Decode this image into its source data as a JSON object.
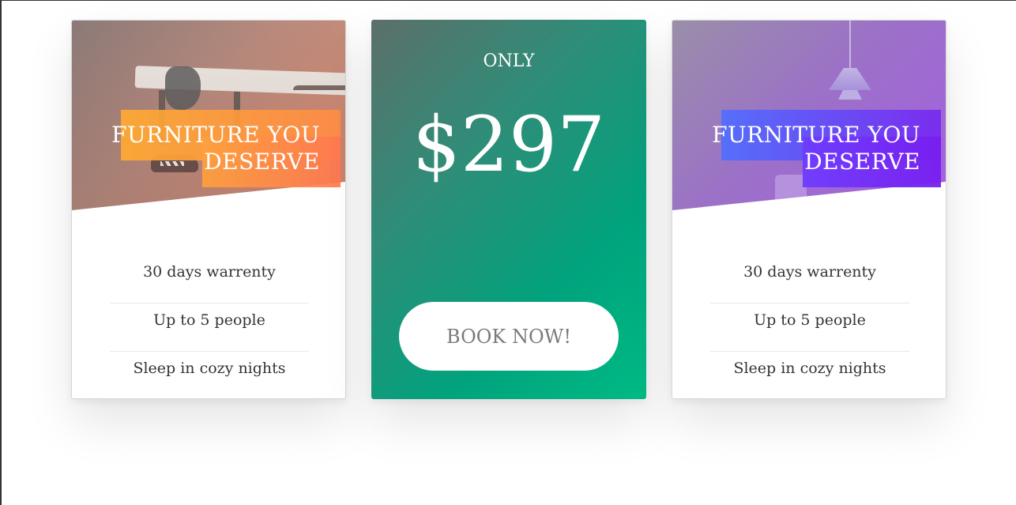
{
  "cards": [
    {
      "headline_line1": "FURNITURE YOU",
      "headline_line2": "DESERVE",
      "theme": "orange",
      "accent_colors": [
        "#ffaa32",
        "#ff7850"
      ],
      "features": [
        "30 days warrenty",
        "Up to 5 people",
        "Sleep in cozy nights"
      ]
    },
    {
      "label": "ONLY",
      "price": "$297",
      "button_label": "BOOK NOW!",
      "accent_colors": [
        "#5c6f6a",
        "#00bb84"
      ]
    },
    {
      "headline_line1": "FURNITURE YOU",
      "headline_line2": "DESERVE",
      "theme": "purple",
      "accent_colors": [
        "#506eff",
        "#7828f0"
      ],
      "features": [
        "30 days warrenty",
        "Up to 5 people",
        "Sleep in cozy nights"
      ]
    }
  ]
}
